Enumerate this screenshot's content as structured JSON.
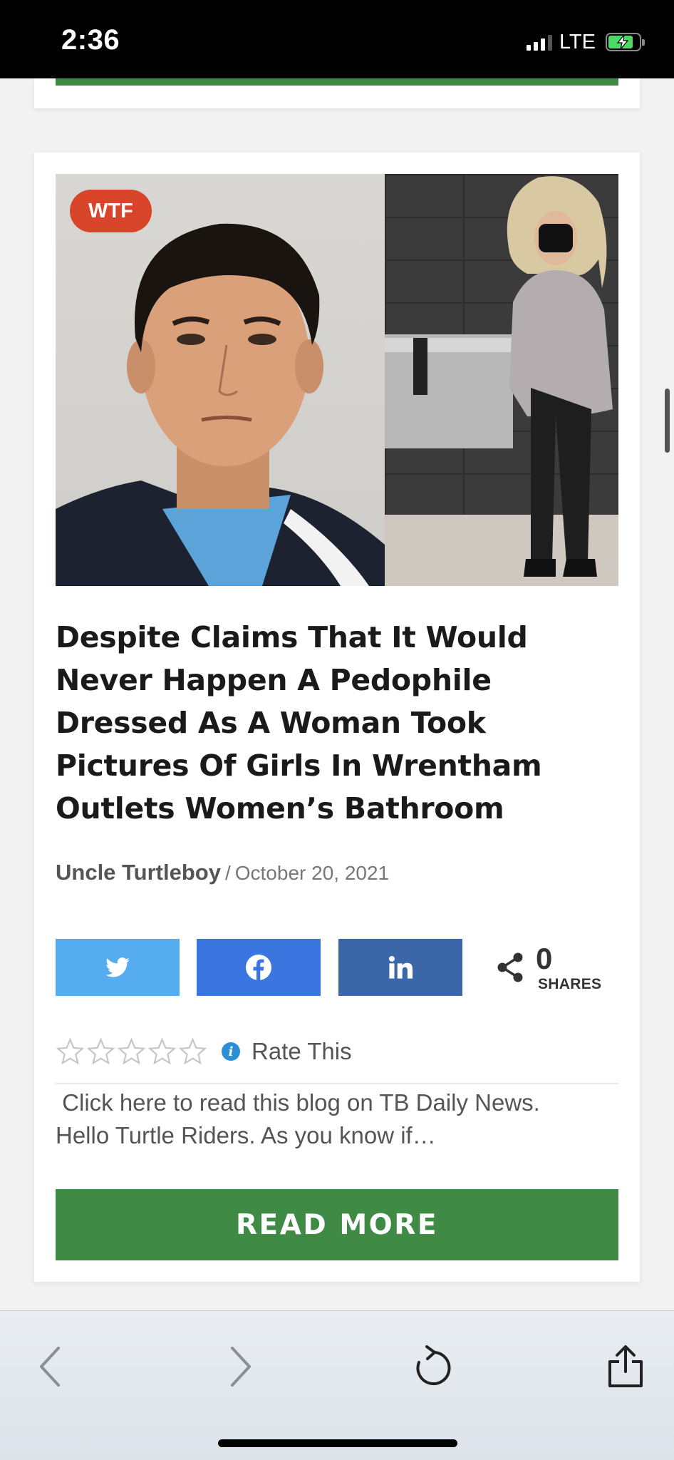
{
  "status_bar": {
    "time": "2:36",
    "network": "LTE"
  },
  "article": {
    "category_tag": "WTF",
    "title": "Despite Claims That It Would Never Happen A Pedophile Dressed As A Woman Took Pictures Of Girls In Wrentham Outlets Women’s Bathroom",
    "author": "Uncle Turtleboy",
    "separator": "/",
    "date": "October 20, 2021",
    "rating": {
      "stars": 5,
      "filled": 0,
      "label": "Rate This"
    },
    "excerpt_line1": " Click here to read this blog on TB Daily News.",
    "excerpt_line2": "Hello Turtle Riders. As you know if…",
    "read_more_label": "READ MORE"
  },
  "share": {
    "count": "0",
    "label": "SHARES",
    "networks": [
      "twitter",
      "facebook",
      "linkedin"
    ]
  },
  "colors": {
    "tag": "#d9452a",
    "twitter": "#55acee",
    "facebook": "#3b76e0",
    "linkedin": "#3b67a8",
    "read_more": "#3f8a44"
  },
  "icons": {
    "share": "share-icon",
    "info": "info-icon",
    "back": "chevron-left-icon",
    "forward": "chevron-right-icon",
    "reload": "reload-icon",
    "share_sheet": "share-sheet-icon"
  }
}
